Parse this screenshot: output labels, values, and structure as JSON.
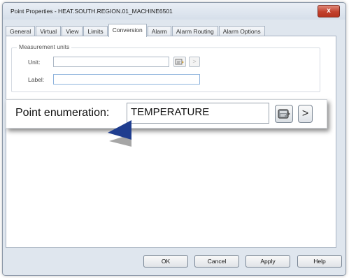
{
  "window": {
    "title": "Point Properties - HEAT.SOUTH.REGION.01_MACHINE6501",
    "close_glyph": "x"
  },
  "tabs": [
    {
      "label": "General"
    },
    {
      "label": "Virtual"
    },
    {
      "label": "View"
    },
    {
      "label": "Limits"
    },
    {
      "label": "Conversion",
      "active": true
    },
    {
      "label": "Alarm"
    },
    {
      "label": "Alarm Routing"
    },
    {
      "label": "Alarm Options"
    }
  ],
  "measurement_units": {
    "group_label": "Measurement units",
    "unit_label": "Unit:",
    "unit_value": "",
    "label_label": "Label:",
    "label_value": "",
    "next_glyph": ">"
  },
  "callout": {
    "label": "Point enumeration:",
    "value": "TEMPERATURE",
    "next_glyph": ">"
  },
  "footer_buttons": {
    "ok": "OK",
    "cancel": "Cancel",
    "apply": "Apply",
    "help": "Help"
  },
  "colors": {
    "arrow": "#1f3d8f",
    "close_button": "#c2412e"
  }
}
